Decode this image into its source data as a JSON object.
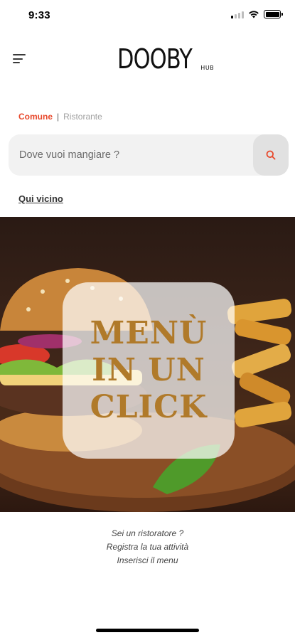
{
  "status_bar": {
    "time": "9:33"
  },
  "header": {
    "logo_main": "DOOBY",
    "logo_sub": "HUB"
  },
  "search_type": {
    "active": "Comune",
    "separator": "|",
    "inactive": "Ristorante"
  },
  "search": {
    "placeholder": "Dove vuoi mangiare ?"
  },
  "nearby": {
    "label": "Qui vicino"
  },
  "banner": {
    "line1": "MENÙ",
    "line2": "IN UN",
    "line3": "CLICK"
  },
  "register": {
    "line1": "Sei un ristoratore ?",
    "line2": "Registra la tua attività",
    "line3": "Inserisci il menu"
  },
  "colors": {
    "accent": "#e8492c",
    "search_bg": "#f2f2f2"
  },
  "icons": {
    "menu": "menu-icon",
    "search": "search-icon",
    "wifi": "wifi-icon",
    "battery": "battery-icon"
  }
}
